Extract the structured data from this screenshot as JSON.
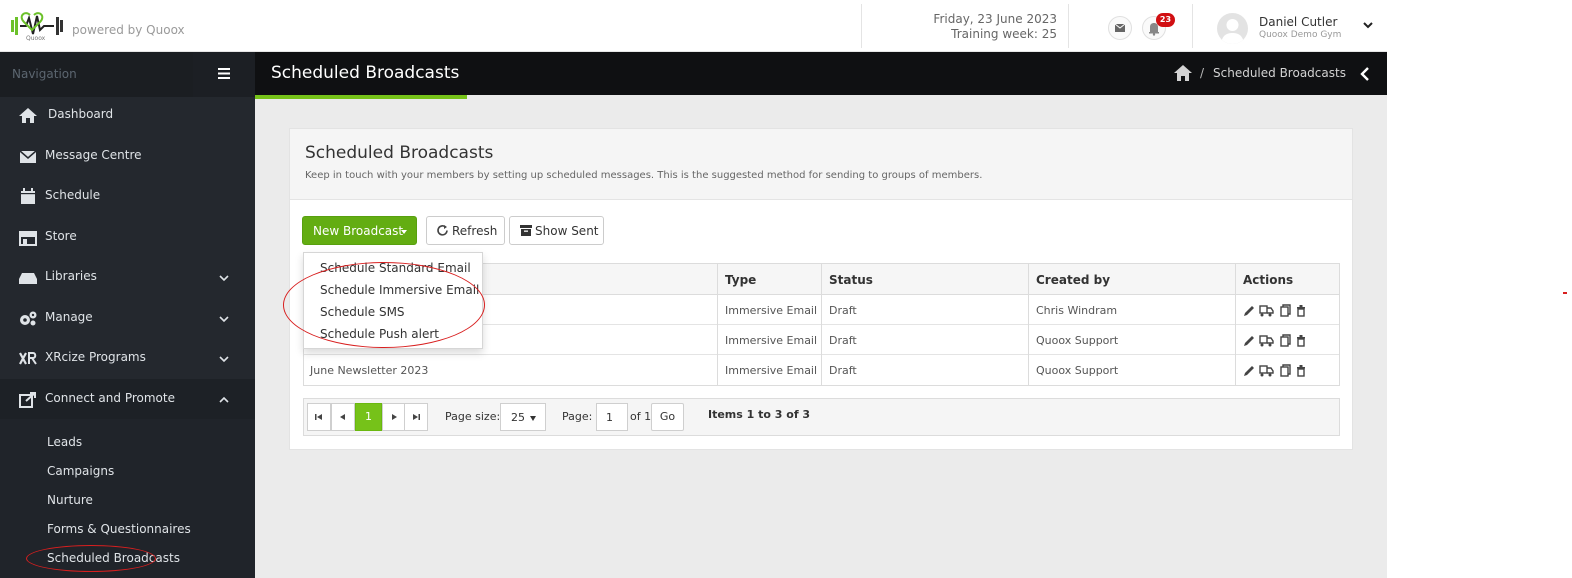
{
  "header": {
    "powered_by": "powered by Quoox",
    "date": "Friday, 23 June 2023",
    "training_week": "Training week: 25",
    "notification_count": "23",
    "user_name": "Daniel Cutler",
    "user_gym": "Quoox Demo Gym"
  },
  "sidebar": {
    "title": "Navigation",
    "items": [
      {
        "label": "Dashboard",
        "icon": "home-icon"
      },
      {
        "label": "Message Centre",
        "icon": "envelope-icon"
      },
      {
        "label": "Schedule",
        "icon": "calendar-icon"
      },
      {
        "label": "Store",
        "icon": "store-icon"
      },
      {
        "label": "Libraries",
        "icon": "drive-icon"
      },
      {
        "label": "Manage",
        "icon": "cogs-icon"
      },
      {
        "label": "XRcize Programs",
        "icon": "xr-icon"
      },
      {
        "label": "Connect and Promote",
        "icon": "share-icon"
      }
    ],
    "subitems": [
      "Leads",
      "Campaigns",
      "Nurture",
      "Forms & Questionnaires",
      "Scheduled Broadcasts"
    ]
  },
  "titlebar": {
    "title": "Scheduled Broadcasts",
    "breadcrumb_current": "Scheduled Broadcasts",
    "breadcrumb_sep": "/"
  },
  "panel": {
    "title": "Scheduled Broadcasts",
    "description": "Keep in touch with your members by setting up scheduled messages. This is the suggested method for sending to groups of members."
  },
  "toolbar": {
    "new_broadcast": "New Broadcast",
    "refresh": "Refresh",
    "show_sent": "Show Sent"
  },
  "dropdown": {
    "items": [
      "Schedule Standard Email",
      "Schedule Immersive Email",
      "Schedule SMS",
      "Schedule Push alert"
    ]
  },
  "table": {
    "columns": [
      "Type",
      "Status",
      "Created by",
      "Actions"
    ],
    "rows": [
      {
        "name": "",
        "type": "Immersive Email",
        "status": "Draft",
        "created_by": "Chris Windram"
      },
      {
        "name": "",
        "type": "Immersive Email",
        "status": "Draft",
        "created_by": "Quoox Support"
      },
      {
        "name": "June Newsletter 2023",
        "type": "Immersive Email",
        "status": "Draft",
        "created_by": "Quoox Support"
      }
    ]
  },
  "pager": {
    "current_page": "1",
    "page_size_label": "Page size:",
    "page_size": "25",
    "page_label": "Page:",
    "page_input": "1",
    "of_label": "of 1",
    "go": "Go",
    "items": "Items 1 to 3 of 3"
  },
  "colors": {
    "accent_green": "#76c219",
    "button_green": "#63ad12",
    "annotation_red": "#d81f1f",
    "sidebar_bg": "#24282e",
    "badge_red": "#d10f12"
  }
}
